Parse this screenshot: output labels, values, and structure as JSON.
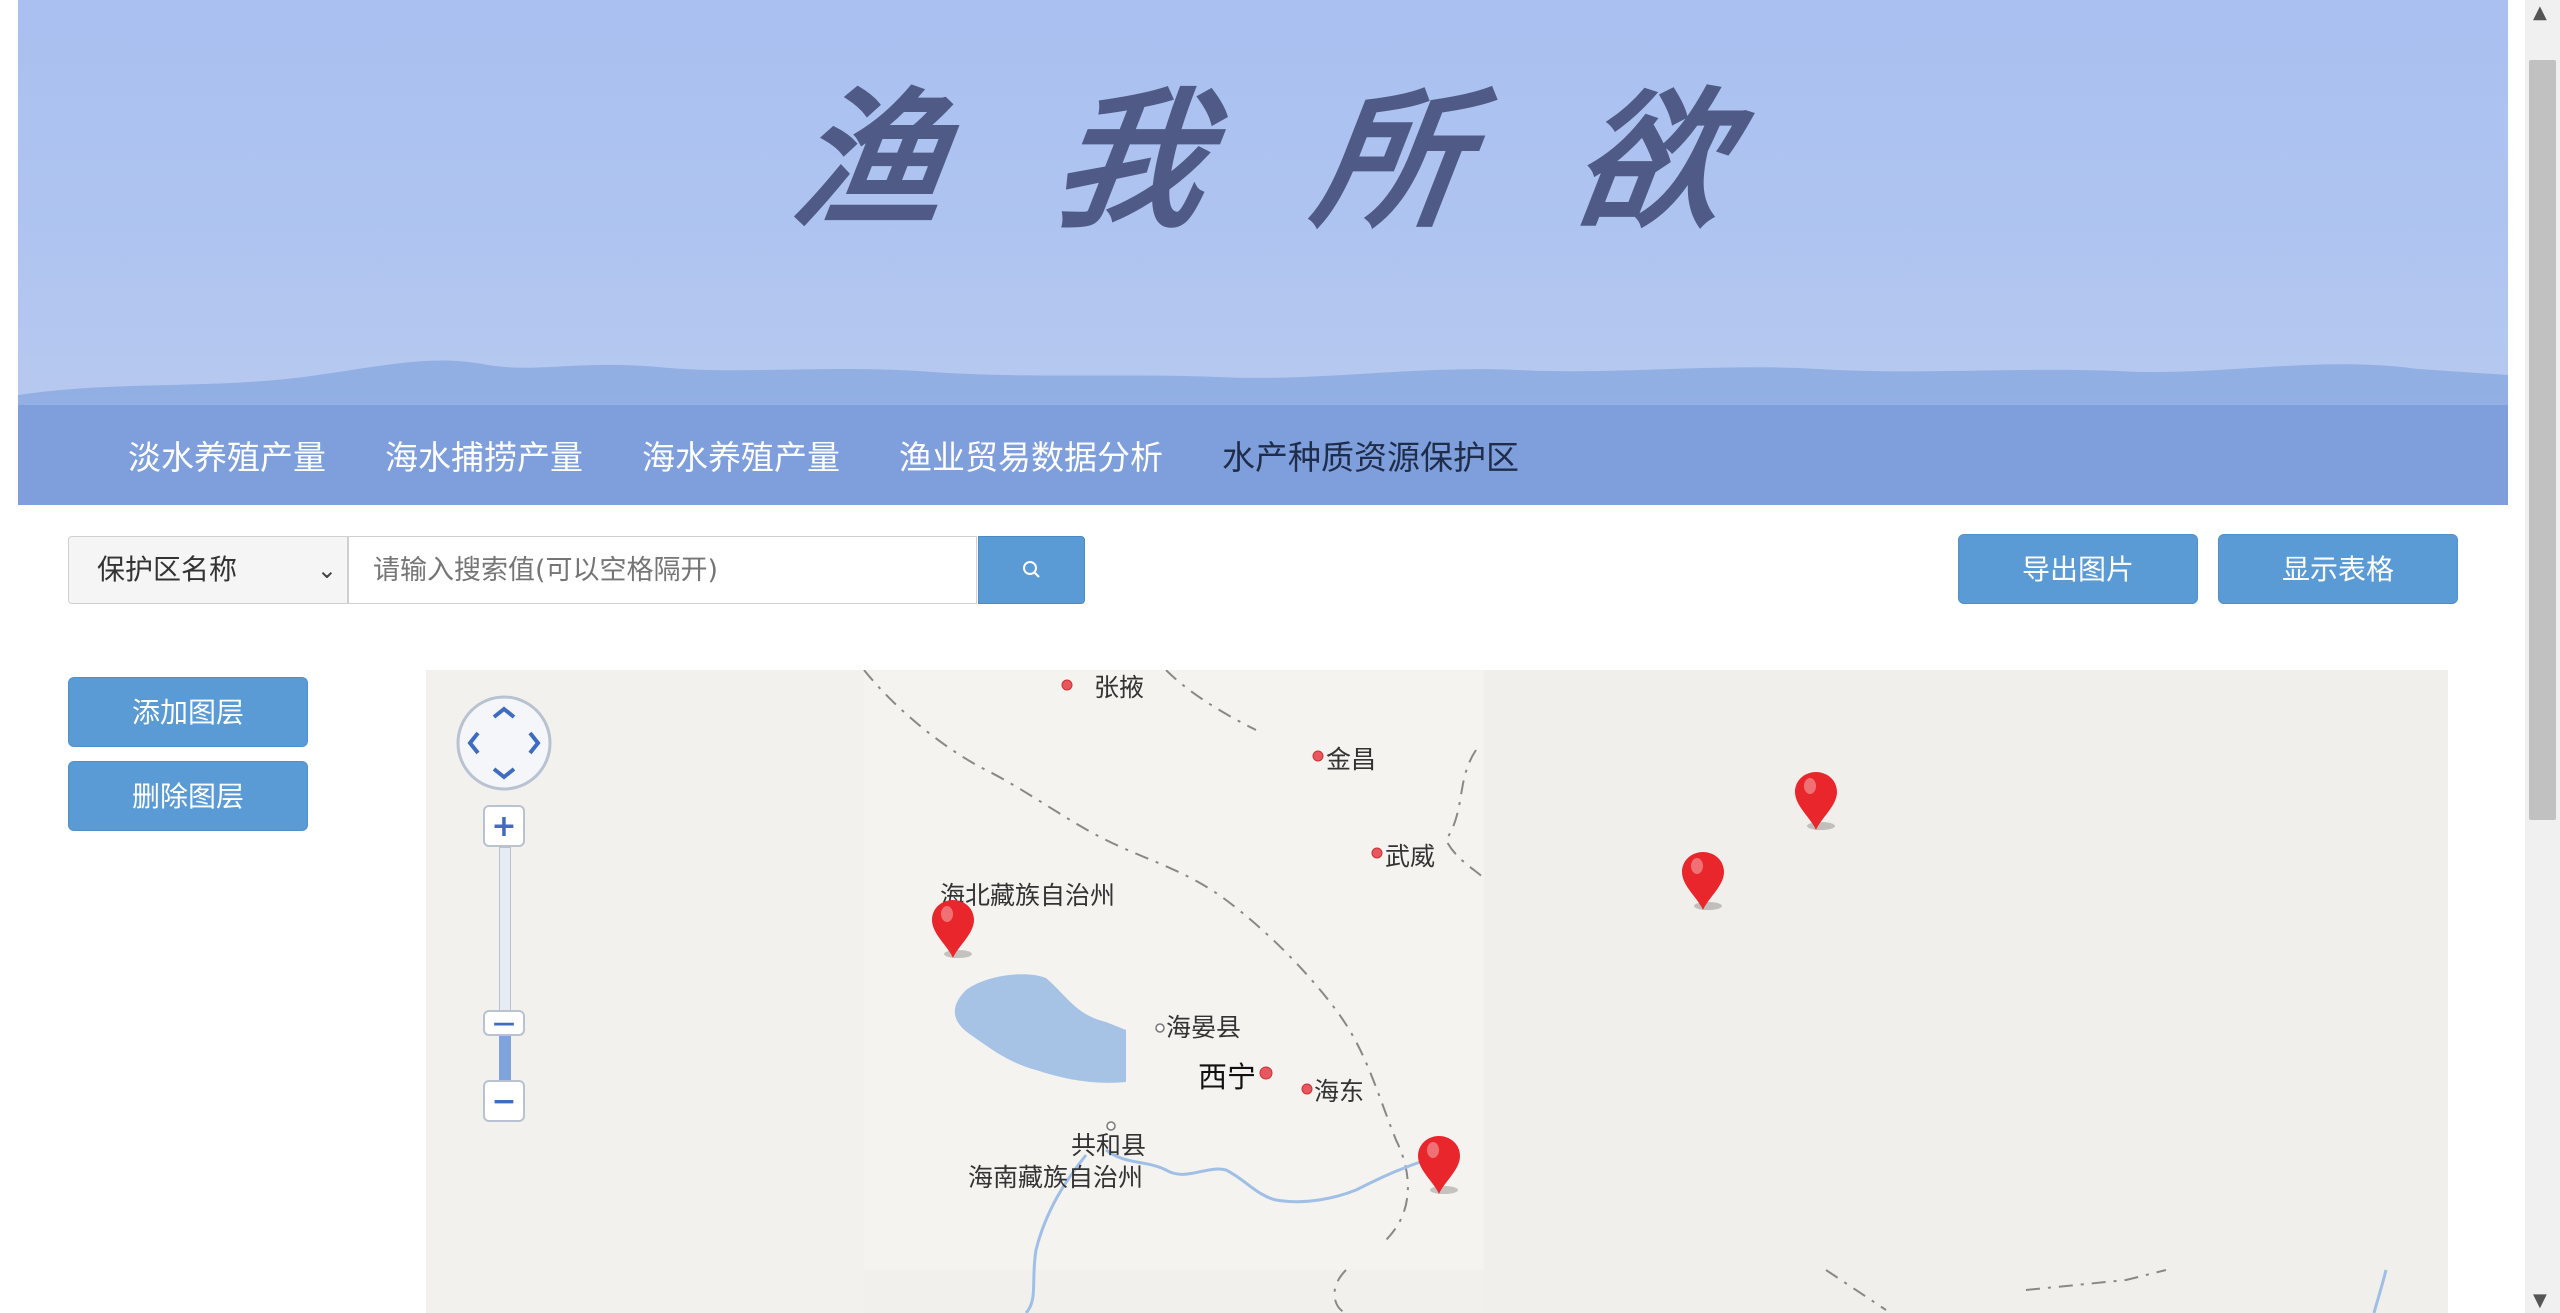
{
  "banner": {
    "title": "渔我所欲"
  },
  "nav": {
    "items": [
      "淡水养殖产量",
      "海水捕捞产量",
      "海水养殖产量",
      "渔业贸易数据分析",
      "水产种质资源保护区"
    ]
  },
  "toolbar": {
    "select_value": "保护区名称",
    "search_placeholder": "请输入搜索值(可以空格隔开)",
    "export_label": "导出图片",
    "table_label": "显示表格"
  },
  "layers": {
    "add_label": "添加图层",
    "delete_label": "删除图层"
  },
  "map": {
    "labels": {
      "zhangye": "张掖",
      "jinchang": "金昌",
      "wuwei": "武威",
      "haibei": "海北藏族自治州",
      "haiyan": "海晏县",
      "xining": "西宁",
      "haidong": "海东",
      "gonghe": "共和县",
      "hainan": "海南藏族自治州"
    },
    "zoom": {
      "plus": "+",
      "minus": "−"
    }
  },
  "colors": {
    "accent": "#5b9bd5",
    "nav": "#7e9edc",
    "marker": "#e8262c",
    "water": "#a6c3e6"
  }
}
